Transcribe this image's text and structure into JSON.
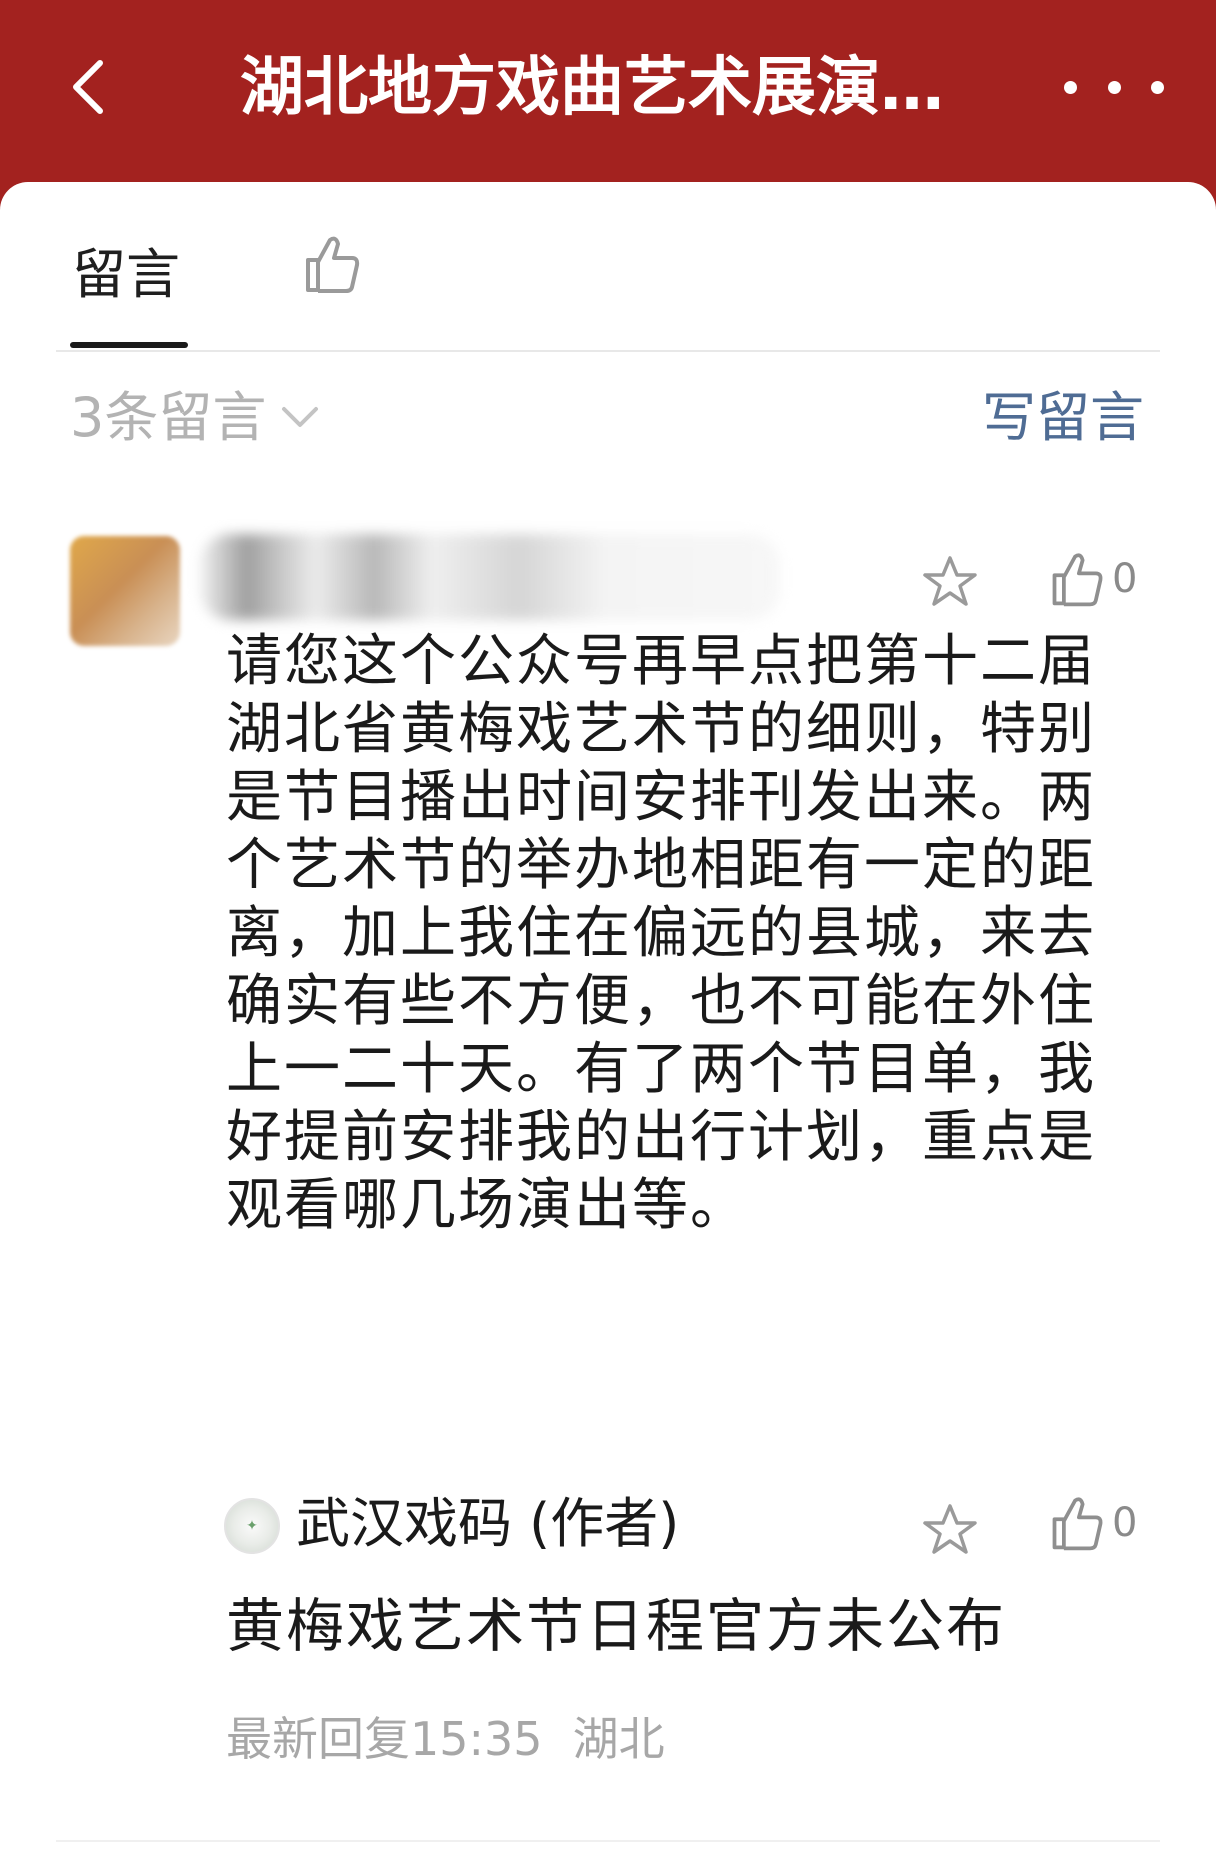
{
  "header": {
    "title": "湖北地方戏曲艺术展演…",
    "back_icon": "chevron-left-icon",
    "more_icon": "more-horizontal-icon",
    "background": "#a3221f"
  },
  "tabs": {
    "comments_label": "留言",
    "like_icon": "thumbs-up-icon"
  },
  "comments_header": {
    "count_label": "3条留言",
    "write_label": "写留言",
    "write_color": "#4f6c94"
  },
  "comment": {
    "like_count": "0",
    "text": "请您这个公众号再早点把第十二届湖北省黄梅戏艺术节的细则，特别是节目播出时间安排刊发出来。两个艺术节的举办地相距有一定的距离，加上我住在偏远的县城，来去确实有些不方便，也不可能在外住上一二十天。有了两个节目单，我好提前安排我的出行计划，重点是观看哪几场演出等。"
  },
  "reply": {
    "author": "武汉戏码 (作者)",
    "like_count": "0",
    "text": "黄梅戏艺术节日程官方未公布",
    "meta_time": "最新回复15:35",
    "meta_location": "湖北"
  }
}
